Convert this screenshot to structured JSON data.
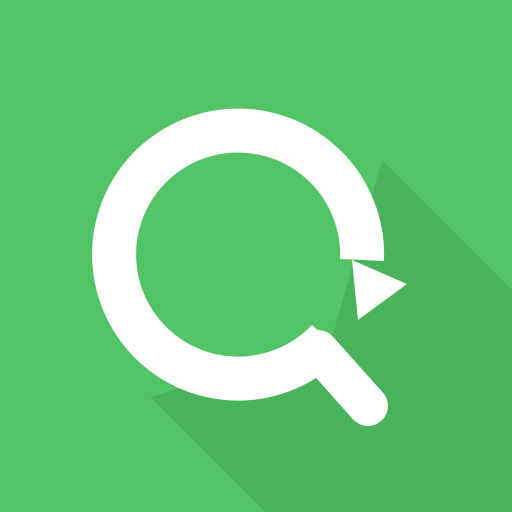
{
  "icon": {
    "name": "refresh-search-icon",
    "colors": {
      "background": "#53C466",
      "long_shadow": "#49B35B",
      "glyph": "#FFFFFF"
    }
  }
}
